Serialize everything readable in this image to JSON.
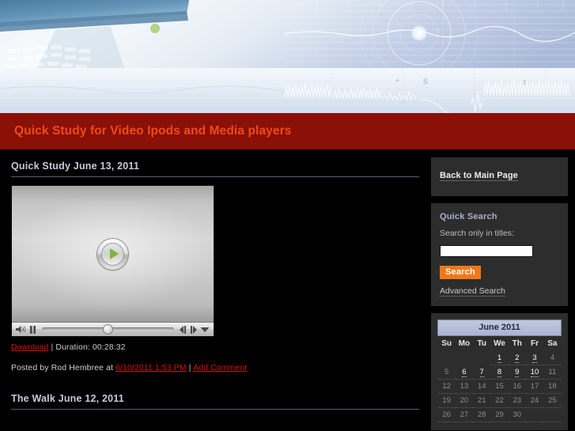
{
  "site": {
    "title": "Quick Study for Video Ipods and Media players",
    "title_color": "#f04a14",
    "titlebar_color": "#8a1008"
  },
  "banner": {
    "name": "technology-abstract-banner"
  },
  "posts": [
    {
      "title": "Quick Study June 13, 2011",
      "player": {
        "play_icon": "play-icon",
        "volume_icon": "volume-icon",
        "pause_icon": "pause-icon",
        "step_back_icon": "step-back-icon",
        "step_forward_icon": "step-forward-icon",
        "menu_icon": "chevron-down-icon"
      },
      "download_label": "Download",
      "separator": "|",
      "duration_label": "Duration: 00:28:32",
      "posted_prefix": "Posted by Rod Hembree at",
      "posted_date": "6/10/2011 1:53 PM",
      "comment_label": "Add Comment"
    },
    {
      "title": "The Walk June 12, 2011"
    }
  ],
  "sidebar": {
    "nav": {
      "label": "Back to Main Page"
    },
    "search": {
      "heading": "Quick Search",
      "label": "Search only in titles:",
      "value": "",
      "placeholder": "",
      "button_label": "Search",
      "button_color": "#f07818",
      "advanced_label": "Advanced Search"
    },
    "calendar": {
      "title": "June 2011",
      "dow": [
        "Su",
        "Mo",
        "Tu",
        "We",
        "Th",
        "Fr",
        "Sa"
      ],
      "weeks": [
        [
          {
            "day": "",
            "link": false
          },
          {
            "day": "",
            "link": false
          },
          {
            "day": "",
            "link": false
          },
          {
            "day": "1",
            "link": true
          },
          {
            "day": "2",
            "link": true
          },
          {
            "day": "3",
            "link": true
          },
          {
            "day": "4",
            "link": false
          }
        ],
        [
          {
            "day": "5",
            "link": false
          },
          {
            "day": "6",
            "link": true
          },
          {
            "day": "7",
            "link": true
          },
          {
            "day": "8",
            "link": true
          },
          {
            "day": "9",
            "link": true
          },
          {
            "day": "10",
            "link": true
          },
          {
            "day": "11",
            "link": false
          }
        ],
        [
          {
            "day": "12",
            "link": false
          },
          {
            "day": "13",
            "link": false
          },
          {
            "day": "14",
            "link": false
          },
          {
            "day": "15",
            "link": false
          },
          {
            "day": "16",
            "link": false
          },
          {
            "day": "17",
            "link": false
          },
          {
            "day": "18",
            "link": false
          }
        ],
        [
          {
            "day": "19",
            "link": false
          },
          {
            "day": "20",
            "link": false
          },
          {
            "day": "21",
            "link": false
          },
          {
            "day": "22",
            "link": false
          },
          {
            "day": "23",
            "link": false
          },
          {
            "day": "24",
            "link": false
          },
          {
            "day": "25",
            "link": false
          }
        ],
        [
          {
            "day": "26",
            "link": false
          },
          {
            "day": "27",
            "link": false
          },
          {
            "day": "28",
            "link": false
          },
          {
            "day": "29",
            "link": false
          },
          {
            "day": "30",
            "link": false
          },
          {
            "day": "",
            "link": false
          },
          {
            "day": "",
            "link": false
          }
        ]
      ]
    }
  }
}
